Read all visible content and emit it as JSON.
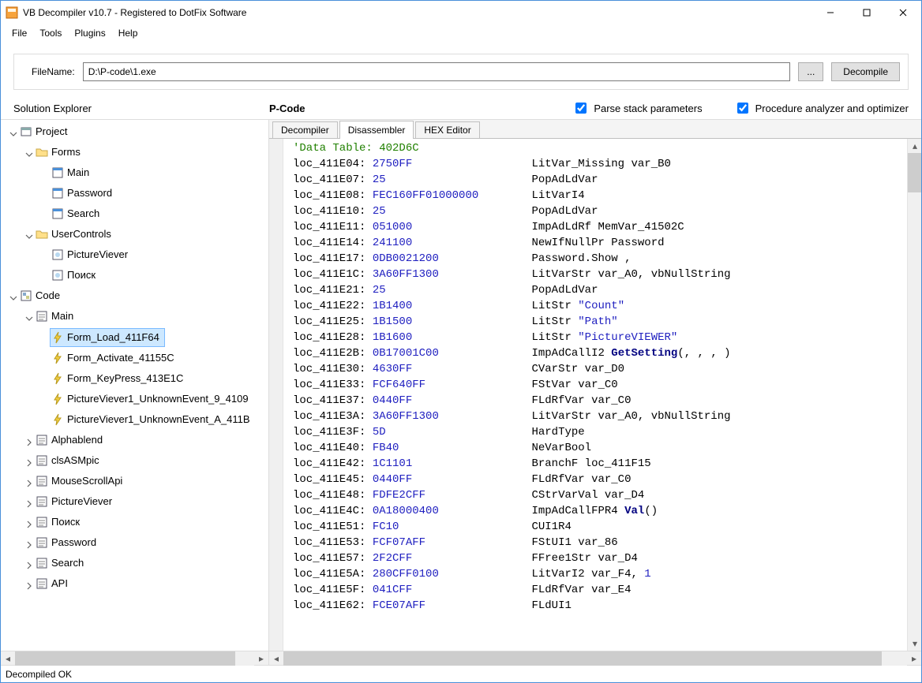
{
  "titlebar": {
    "title": "VB Decompiler v10.7 - Registered to DotFix Software"
  },
  "menu": [
    "File",
    "Tools",
    "Plugins",
    "Help"
  ],
  "filebar": {
    "label": "FileName:",
    "value": "D:\\P-code\\1.exe",
    "browse": "...",
    "decompile": "Decompile"
  },
  "panels": {
    "explorer": "Solution Explorer",
    "pcode": "P-Code",
    "check1": "Parse stack parameters",
    "check1_checked": true,
    "check2": "Procedure analyzer and optimizer",
    "check2_checked": true
  },
  "tabs": {
    "t1": "Decompiler",
    "t2": "Disassembler",
    "t3": "HEX Editor",
    "active": 1
  },
  "tree": {
    "project": "Project",
    "forms": "Forms",
    "forms_children": [
      "Main",
      "Password",
      "Search"
    ],
    "usercontrols": "UserControls",
    "uc_children": [
      "PictureViever",
      "Поиск"
    ],
    "code": "Code",
    "main": "Main",
    "main_children": [
      "Form_Load_411F64",
      "Form_Activate_41155C",
      "Form_KeyPress_413E1C",
      "PictureViever1_UnknownEvent_9_4109",
      "PictureViever1_UnknownEvent_A_411B"
    ],
    "code_rest": [
      "Alphablend",
      "clsASMpic",
      "MouseScrollApi",
      "PictureViever",
      "Поиск",
      "Password",
      "Search",
      "API"
    ]
  },
  "code_header": "'Data Table: 402D6C",
  "code_rows": [
    {
      "loc": "loc_411E04:",
      "hex": "2750FF",
      "asm": "LitVar_Missing var_B0"
    },
    {
      "loc": "loc_411E07:",
      "hex": "25",
      "asm": "PopAdLdVar"
    },
    {
      "loc": "loc_411E08:",
      "hex": "FEC160FF01000000",
      "asm": "LitVarI4"
    },
    {
      "loc": "loc_411E10:",
      "hex": "25",
      "asm": "PopAdLdVar"
    },
    {
      "loc": "loc_411E11:",
      "hex": "051000",
      "asm": "ImpAdLdRf MemVar_41502C"
    },
    {
      "loc": "loc_411E14:",
      "hex": "241100",
      "asm": "NewIfNullPr Password"
    },
    {
      "loc": "loc_411E17:",
      "hex": "0DB0021200",
      "asm": "Password.Show ,"
    },
    {
      "loc": "loc_411E1C:",
      "hex": "3A60FF1300",
      "asm": "LitVarStr var_A0, vbNullString"
    },
    {
      "loc": "loc_411E21:",
      "hex": "25",
      "asm": "PopAdLdVar"
    },
    {
      "loc": "loc_411E22:",
      "hex": "1B1400",
      "asm": "LitStr ",
      "str": "\"Count\""
    },
    {
      "loc": "loc_411E25:",
      "hex": "1B1500",
      "asm": "LitStr ",
      "str": "\"Path\""
    },
    {
      "loc": "loc_411E28:",
      "hex": "1B1600",
      "asm": "LitStr ",
      "str": "\"PictureVIEWER\""
    },
    {
      "loc": "loc_411E2B:",
      "hex": "0B17001C00",
      "asm": "ImpAdCallI2 ",
      "func": "GetSetting",
      "tail": "(, , , )"
    },
    {
      "loc": "loc_411E30:",
      "hex": "4630FF",
      "asm": "CVarStr var_D0"
    },
    {
      "loc": "loc_411E33:",
      "hex": "FCF640FF",
      "asm": "FStVar var_C0"
    },
    {
      "loc": "loc_411E37:",
      "hex": "0440FF",
      "asm": "FLdRfVar var_C0"
    },
    {
      "loc": "loc_411E3A:",
      "hex": "3A60FF1300",
      "asm": "LitVarStr var_A0, vbNullString"
    },
    {
      "loc": "loc_411E3F:",
      "hex": "5D",
      "asm": "HardType"
    },
    {
      "loc": "loc_411E40:",
      "hex": "FB40",
      "asm": "NeVarBool"
    },
    {
      "loc": "loc_411E42:",
      "hex": "1C1101",
      "asm": "BranchF loc_411F15"
    },
    {
      "loc": "loc_411E45:",
      "hex": "0440FF",
      "asm": "FLdRfVar var_C0"
    },
    {
      "loc": "loc_411E48:",
      "hex": "FDFE2CFF",
      "asm": "CStrVarVal var_D4"
    },
    {
      "loc": "loc_411E4C:",
      "hex": "0A18000400",
      "asm": "ImpAdCallFPR4 ",
      "func": "Val",
      "tail": "()"
    },
    {
      "loc": "loc_411E51:",
      "hex": "FC10",
      "asm": "CUI1R4"
    },
    {
      "loc": "loc_411E53:",
      "hex": "FCF07AFF",
      "asm": "FStUI1 var_86"
    },
    {
      "loc": "loc_411E57:",
      "hex": "2F2CFF",
      "asm": "FFree1Str var_D4"
    },
    {
      "loc": "loc_411E5A:",
      "hex": "280CFF0100",
      "asm": "LitVarI2 var_F4, ",
      "num": "1"
    },
    {
      "loc": "loc_411E5F:",
      "hex": "041CFF",
      "asm": "FLdRfVar var_E4"
    },
    {
      "loc": "loc_411E62:",
      "hex": "FCE07AFF",
      "asm": "FLdUI1"
    }
  ],
  "status": "Decompiled OK"
}
